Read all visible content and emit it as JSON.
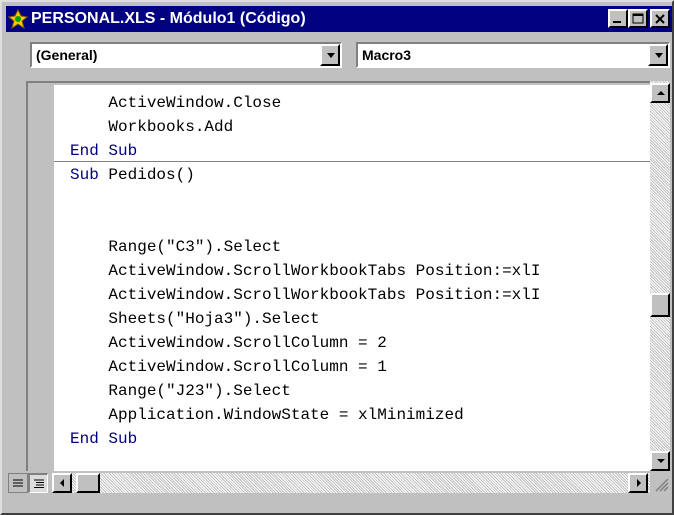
{
  "window": {
    "title": "PERSONAL.XLS - Módulo1 (Código)",
    "icon": "excel-vba-icon"
  },
  "toolbar": {
    "object_combo": "(General)",
    "procedure_combo": "Macro3"
  },
  "code": {
    "lines": [
      "    ActiveWindow.Close",
      "    Workbooks.Add",
      "End Sub",
      "Sub Pedidos()",
      "",
      "",
      "    Range(\"C3\").Select",
      "    ActiveWindow.ScrollWorkbookTabs Position:=xlI",
      "    ActiveWindow.ScrollWorkbookTabs Position:=xlI",
      "    Sheets(\"Hoja3\").Select",
      "    ActiveWindow.ScrollColumn = 2",
      "    ActiveWindow.ScrollColumn = 1",
      "    Range(\"J23\").Select",
      "    Application.WindowState = xlMinimized",
      "End Sub"
    ],
    "keyword_color": "#00007f"
  },
  "colors": {
    "titlebar": "#000080",
    "face": "#c0c0c0"
  }
}
